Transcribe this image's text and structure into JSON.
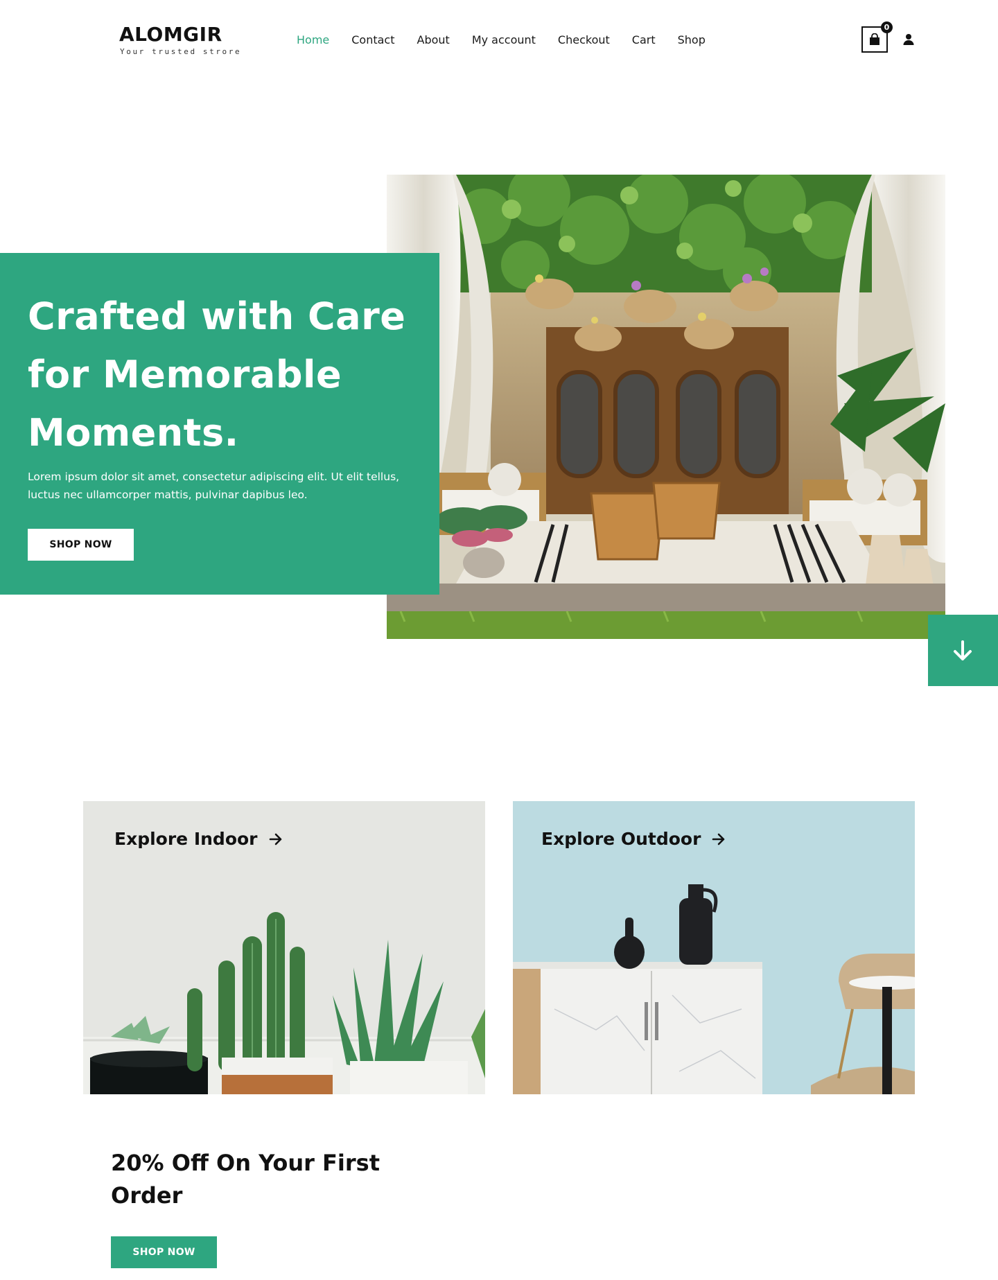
{
  "header": {
    "logo_name": "ALOMGIR",
    "logo_tagline": "Your trusted strore",
    "nav": [
      "Home",
      "Contact",
      "About",
      "My account",
      "Checkout",
      "Cart",
      "Shop"
    ],
    "active_nav": "Home",
    "cart_count": "0",
    "icons": [
      "shopping-bag-icon",
      "user-icon"
    ]
  },
  "hero": {
    "title": "Crafted with Care for Memorable Moments.",
    "description": "Lorem ipsum dolor sit amet, consectetur adipiscing elit. Ut elit tellus, luctus nec ullamcorper mattis, pulvinar dapibus leo.",
    "button": "SHOP NOW",
    "scroll_icon": "arrow-down-icon"
  },
  "explore": {
    "indoor": "Explore Indoor",
    "outdoor": "Explore Outdoor",
    "arrow_icon": "arrow-right-icon"
  },
  "promo": {
    "title": "20% Off On Your First Order",
    "button": "SHOP NOW"
  },
  "colors": {
    "accent": "#2ea680",
    "text": "#111111",
    "indoor_bg": "#e5e6e2",
    "outdoor_bg": "#bcdbe1"
  }
}
